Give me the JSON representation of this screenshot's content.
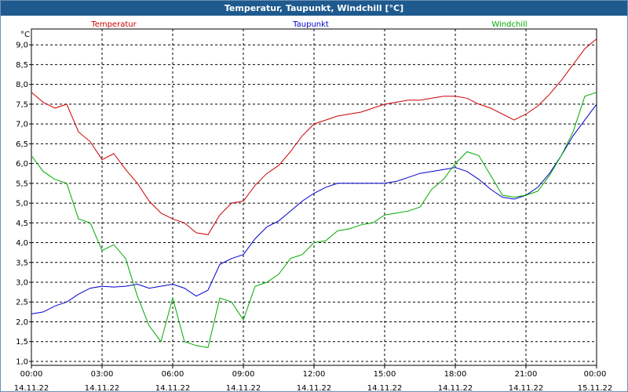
{
  "window": {
    "title": "Temperatur, Taupunkt, Windchill [°C]"
  },
  "chart_data": {
    "type": "line",
    "title": "Temperatur, Taupunkt, Windchill [°C]",
    "ylabel": "°C",
    "ylim": [
      0.9,
      9.4
    ],
    "yticks": [
      "1,0",
      "1,5",
      "2,0",
      "2,5",
      "3,0",
      "3,5",
      "4,0",
      "4,5",
      "5,0",
      "5,5",
      "6,0",
      "6,5",
      "7,0",
      "7,5",
      "8,0",
      "8,5",
      "9,0"
    ],
    "xlim": [
      0,
      24
    ],
    "xticks": [
      {
        "time": "00:00",
        "date": "14.11.22"
      },
      {
        "time": "03:00",
        "date": "14.11.22"
      },
      {
        "time": "06:00",
        "date": "14.11.22"
      },
      {
        "time": "09:00",
        "date": "14.11.22"
      },
      {
        "time": "12:00",
        "date": "14.11.22"
      },
      {
        "time": "15:00",
        "date": "14.11.22"
      },
      {
        "time": "18:00",
        "date": "14.11.22"
      },
      {
        "time": "21:00",
        "date": "14.11.22"
      },
      {
        "time": "00:00",
        "date": "15.11.22"
      }
    ],
    "grid": true,
    "legend_position": "top",
    "series": [
      {
        "name": "Temperatur",
        "color": "#cc0000",
        "x": [
          0,
          0.5,
          1,
          1.5,
          2,
          2.5,
          3,
          3.5,
          4,
          4.5,
          5,
          5.5,
          6,
          6.5,
          7,
          7.5,
          8,
          8.5,
          9,
          9.5,
          10,
          10.5,
          11,
          11.5,
          12,
          12.5,
          13,
          13.5,
          14,
          14.5,
          15,
          15.5,
          16,
          16.5,
          17,
          17.5,
          18,
          18.5,
          19,
          19.5,
          20,
          20.5,
          21,
          21.5,
          22,
          22.5,
          23,
          23.5,
          24
        ],
        "y": [
          7.8,
          7.55,
          7.4,
          7.5,
          6.8,
          6.55,
          6.1,
          6.25,
          5.85,
          5.5,
          5.05,
          4.75,
          4.6,
          4.5,
          4.25,
          4.2,
          4.7,
          5.0,
          5.05,
          5.45,
          5.75,
          5.95,
          6.3,
          6.7,
          7.0,
          7.1,
          7.2,
          7.25,
          7.3,
          7.4,
          7.5,
          7.55,
          7.6,
          7.6,
          7.65,
          7.7,
          7.7,
          7.65,
          7.5,
          7.4,
          7.25,
          7.1,
          7.25,
          7.45,
          7.75,
          8.1,
          8.5,
          8.9,
          9.15
        ]
      },
      {
        "name": "Taupunkt",
        "color": "#0000cc",
        "x": [
          0,
          0.5,
          1,
          1.5,
          2,
          2.5,
          3,
          3.5,
          4,
          4.5,
          5,
          5.5,
          6,
          6.5,
          7,
          7.5,
          8,
          8.5,
          9,
          9.5,
          10,
          10.5,
          11,
          11.5,
          12,
          12.5,
          13,
          13.5,
          14,
          14.5,
          15,
          15.5,
          16,
          16.5,
          17,
          17.5,
          18,
          18.5,
          19,
          19.5,
          20,
          20.5,
          21,
          21.5,
          22,
          22.5,
          23,
          23.5,
          24
        ],
        "y": [
          2.2,
          2.25,
          2.4,
          2.5,
          2.7,
          2.85,
          2.9,
          2.88,
          2.9,
          2.95,
          2.85,
          2.9,
          2.95,
          2.85,
          2.65,
          2.8,
          3.45,
          3.6,
          3.7,
          4.1,
          4.4,
          4.55,
          4.8,
          5.05,
          5.25,
          5.4,
          5.5,
          5.5,
          5.5,
          5.5,
          5.5,
          5.55,
          5.65,
          5.75,
          5.8,
          5.85,
          5.9,
          5.8,
          5.6,
          5.35,
          5.15,
          5.1,
          5.2,
          5.4,
          5.75,
          6.2,
          6.7,
          7.1,
          7.5
        ]
      },
      {
        "name": "Windchill",
        "color": "#00aa00",
        "x": [
          0,
          0.5,
          1,
          1.5,
          2,
          2.5,
          3,
          3.5,
          4,
          4.5,
          5,
          5.5,
          6,
          6.5,
          7,
          7.5,
          8,
          8.5,
          9,
          9.5,
          10,
          10.5,
          11,
          11.5,
          12,
          12.5,
          13,
          13.5,
          14,
          14.5,
          15,
          15.5,
          16,
          16.5,
          17,
          17.5,
          18,
          18.5,
          19,
          19.5,
          20,
          20.5,
          21,
          21.5,
          22,
          22.5,
          23,
          23.5,
          24
        ],
        "y": [
          6.2,
          5.8,
          5.6,
          5.5,
          4.6,
          4.5,
          3.8,
          3.95,
          3.6,
          2.65,
          1.9,
          1.5,
          2.6,
          1.5,
          1.4,
          1.35,
          2.6,
          2.5,
          2.05,
          2.9,
          3.0,
          3.2,
          3.6,
          3.7,
          4.0,
          4.05,
          4.3,
          4.35,
          4.45,
          4.5,
          4.7,
          4.75,
          4.8,
          4.9,
          5.35,
          5.6,
          6.0,
          6.3,
          6.2,
          5.7,
          5.2,
          5.15,
          5.2,
          5.3,
          5.7,
          6.2,
          6.8,
          7.7,
          7.8
        ]
      }
    ]
  }
}
